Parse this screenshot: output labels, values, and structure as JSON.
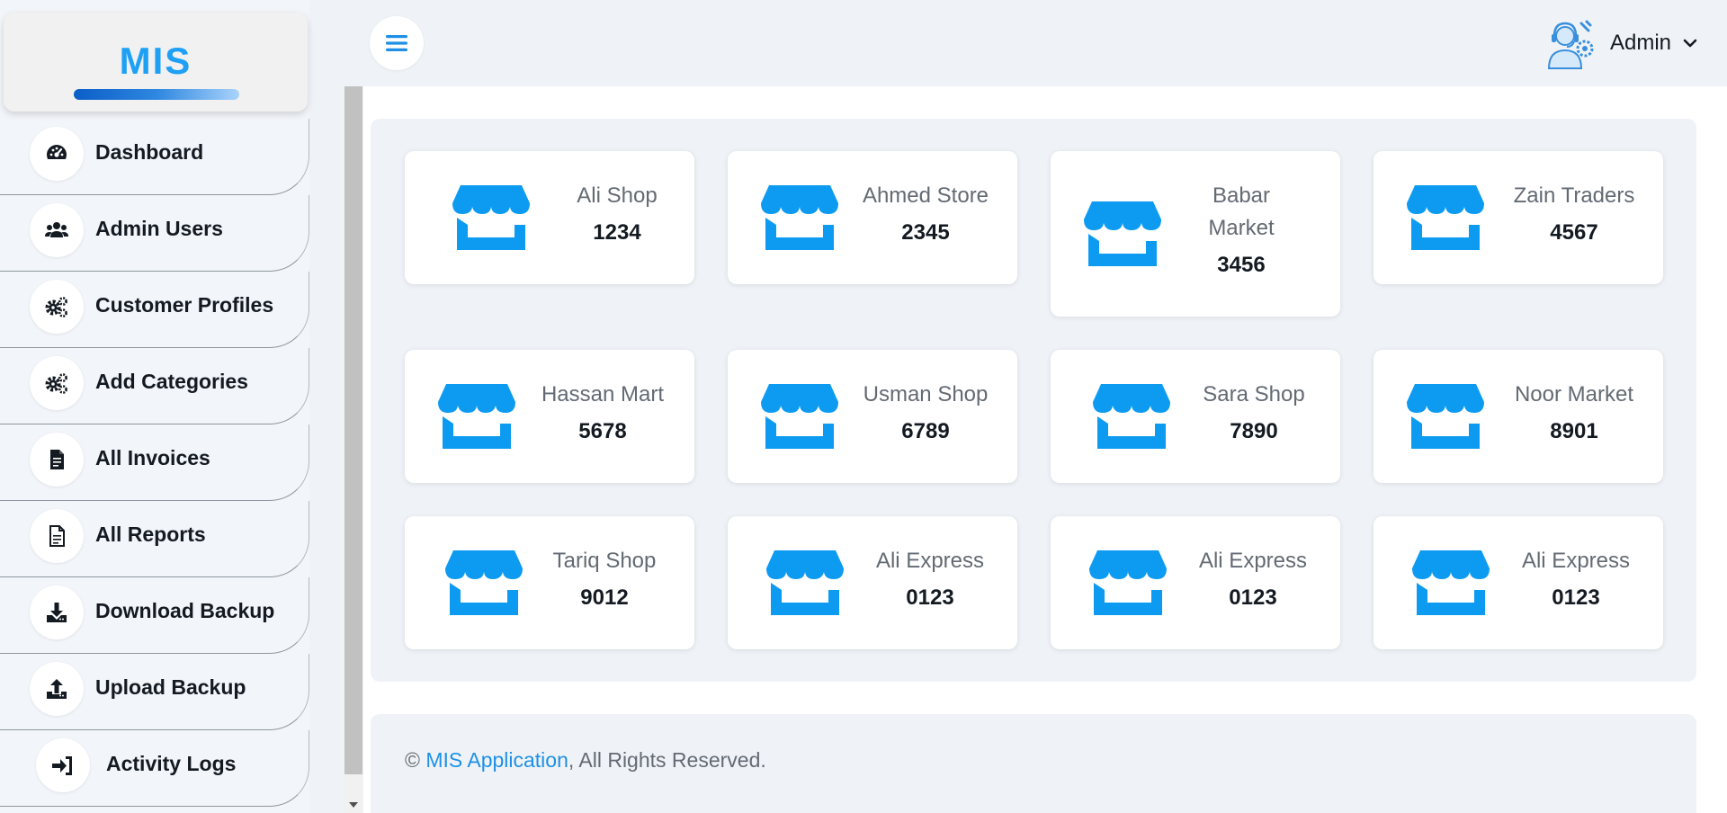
{
  "brand": {
    "logo_text": "MIS",
    "accent_color": "#1ea0f5"
  },
  "sidebar": {
    "items": [
      {
        "label": "Dashboard",
        "icon": "gauge-icon"
      },
      {
        "label": "Admin Users",
        "icon": "users-icon"
      },
      {
        "label": "Customer Profiles",
        "icon": "cogs-icon"
      },
      {
        "label": "Add Categories",
        "icon": "cogs-icon"
      },
      {
        "label": "All Invoices",
        "icon": "invoice-icon"
      },
      {
        "label": "All Reports",
        "icon": "report-icon"
      },
      {
        "label": "Download Backup",
        "icon": "download-icon"
      },
      {
        "label": "Upload Backup",
        "icon": "upload-icon"
      },
      {
        "label": "Activity Logs",
        "icon": "sign-in-icon"
      }
    ]
  },
  "header": {
    "menu_icon": "hamburger-icon",
    "user": {
      "name": "Admin",
      "avatar": "support-agent-avatar",
      "caret": "chevron-down-icon"
    }
  },
  "cards": [
    {
      "name": "Ali Shop",
      "count": "1234",
      "icon": "store-icon"
    },
    {
      "name": "Ahmed Store",
      "count": "2345",
      "icon": "store-icon"
    },
    {
      "name": "Babar Market",
      "count": "3456",
      "icon": "store-icon"
    },
    {
      "name": "Zain Traders",
      "count": "4567",
      "icon": "store-icon"
    },
    {
      "name": "Hassan Mart",
      "count": "5678",
      "icon": "store-icon"
    },
    {
      "name": "Usman Shop",
      "count": "6789",
      "icon": "store-icon"
    },
    {
      "name": "Sara Shop",
      "count": "7890",
      "icon": "store-icon"
    },
    {
      "name": "Noor Market",
      "count": "8901",
      "icon": "store-icon"
    },
    {
      "name": "Tariq Shop",
      "count": "9012",
      "icon": "store-icon"
    },
    {
      "name": "Ali Express",
      "count": "0123",
      "icon": "store-icon"
    },
    {
      "name": "Ali Express",
      "count": "0123",
      "icon": "store-icon"
    },
    {
      "name": "Ali Express",
      "count": "0123",
      "icon": "store-icon"
    }
  ],
  "footer": {
    "prefix": "© ",
    "link_text": "MIS Application",
    "suffix": ", All Rights Reserved."
  }
}
